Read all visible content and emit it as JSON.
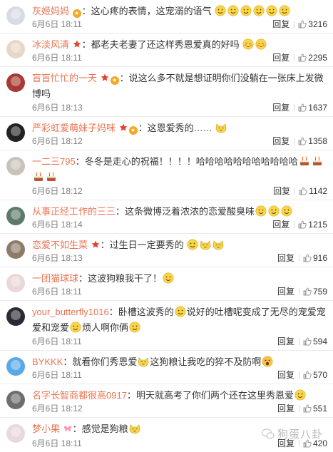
{
  "ui": {
    "reply_label": "回复"
  },
  "comments": [
    {
      "username": "灰姬妈妈",
      "badges": [
        "gold-medal-badge"
      ],
      "text": "这心疼的表情，这宠溺的语气",
      "emojis": [
        "smile",
        "smile",
        "smile",
        "smile",
        "smile",
        "smile"
      ],
      "time": "6月6日 18:11",
      "likes": "3216",
      "avatar_color": "#d7dbe4",
      "avatar_accent": "#3d4a6b"
    },
    {
      "username": "冰淡风清",
      "badges": [
        "red-star-badge"
      ],
      "text": "都老夫老妻了还这样秀恩爱真的好吗",
      "emojis": [
        "shy",
        "shy"
      ],
      "time": "6月6日 18:11",
      "likes": "2295",
      "avatar_color": "#e7d7c8",
      "avatar_accent": "#c7a27a"
    },
    {
      "username": "盲盲忙忙的一天",
      "badges": [
        "red-star-badge",
        "gold-medal-badge"
      ],
      "text": "说这么多不就是想证明你们没躺在一张床上发微博吗",
      "emojis": [],
      "time": "6月6日 18:13",
      "likes": "1637",
      "avatar_color": "#a53b34",
      "avatar_accent": "#f2c0a0"
    },
    {
      "username": "严彩虹爱萌妹子妈咪",
      "badges": [
        "red-star-badge",
        "gold-medal-badge"
      ],
      "text": "这恩爱秀的……",
      "emojis": [
        "cat"
      ],
      "time": "6月6日 18:12",
      "likes": "1358",
      "avatar_color": "#222222",
      "avatar_accent": "#f0d3c0"
    },
    {
      "username": "一二三795",
      "badges": [],
      "text": "冬冬是走心的祝福！！！！哈哈哈哈哈哈哈哈哈哈哈",
      "emojis": [
        "cake",
        "cake",
        "cake",
        "cake"
      ],
      "time": "6月6日 18:12",
      "likes": "1142",
      "avatar_color": "#c9c2b8",
      "avatar_accent": "#8a6d57"
    },
    {
      "username": "从事正经工作的三三",
      "badges": [],
      "text": "这条微博泛着浓浓的恋爱酸臭味",
      "emojis": [
        "smile",
        "smile",
        "smile"
      ],
      "time": "6月6日 18:14",
      "likes": "1215",
      "avatar_color": "#5c7a6a",
      "avatar_accent": "#d9c6a5"
    },
    {
      "username": "恋爱不如生菜",
      "badges": [
        "red-star-badge"
      ],
      "text": "过生日一定要秀的",
      "emojis": [
        "smile",
        "cat",
        "cat"
      ],
      "time": "6月6日 18:13",
      "likes": "916",
      "avatar_color": "#8d7b6a",
      "avatar_accent": "#3a2f29"
    },
    {
      "username": "一团猫球球",
      "badges": [],
      "text": "这波狗粮我干了！",
      "emojis": [
        "smile"
      ],
      "time": "6月6日 18:11",
      "likes": "759",
      "avatar_color": "#ead8d8",
      "avatar_accent": "#c23b3b"
    },
    {
      "username": "your_butterfly1016",
      "badges": [],
      "text": "卧槽这波秀的",
      "text2": "说好的吐槽呢变成了无尽的宠爱宠爱和",
      "text3": "宠爱",
      "text4": "烦人啊你俩",
      "emojis": [],
      "time": "6月6日 18:11",
      "likes": "594",
      "avatar_color": "#2a2a33",
      "avatar_accent": "#e8c9b8"
    },
    {
      "username": "BYKKK",
      "badges": [],
      "text": "就看你们秀恩爱",
      "text2": "这狗粮让我吃的猝不及防啊",
      "emojis": [],
      "time": "6月6日 18:11",
      "likes": "570",
      "avatar_color": "#5aa9e6",
      "avatar_accent": "#ffffff"
    },
    {
      "username": "名字长智商都很高0917",
      "badges": [],
      "text": "明天就高考了你们两个还在这里秀恩爱",
      "emojis": [
        "smile"
      ],
      "time": "6月6日 18:12",
      "likes": "551",
      "avatar_color": "#6d6d6d",
      "avatar_accent": "#d8d8d8"
    },
    {
      "username": "梦小果",
      "badges": [
        "butterfly-badge"
      ],
      "text": "感觉是狗粮",
      "emojis": [
        "cat"
      ],
      "time": "6月6日 18:11",
      "likes": "420",
      "avatar_color": "#e8d9df",
      "avatar_accent": "#b98b99"
    }
  ],
  "watermark": "狗蛋八卦"
}
